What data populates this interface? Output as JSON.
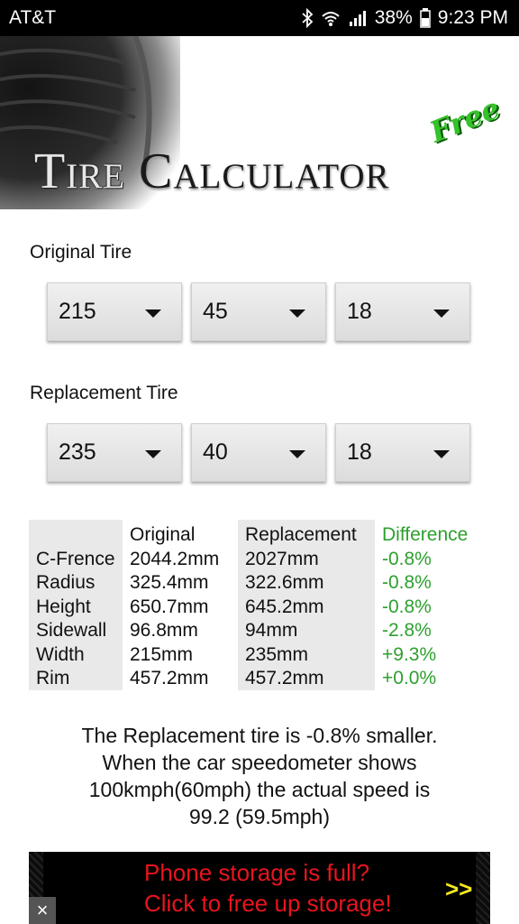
{
  "status_bar": {
    "carrier": "AT&T",
    "battery": "38%",
    "time": "9:23 PM",
    "icons": [
      "bluetooth-icon",
      "wifi-icon",
      "signal-icon",
      "battery-icon"
    ]
  },
  "header": {
    "title_first": "Tire",
    "title_rest": "Calculator",
    "badge": "Free",
    "badge_color": "#36c22a"
  },
  "original_tire": {
    "label": "Original Tire",
    "width": "215",
    "aspect": "45",
    "rim": "18"
  },
  "replacement_tire": {
    "label": "Replacement Tire",
    "width": "235",
    "aspect": "40",
    "rim": "18"
  },
  "table": {
    "headers": [
      "",
      "Original",
      "Replacement",
      "Difference"
    ],
    "rows": [
      {
        "name": "C-Frence",
        "original": "2044.2mm",
        "replacement": "2027mm",
        "difference": "-0.8%"
      },
      {
        "name": "Radius",
        "original": "325.4mm",
        "replacement": "322.6mm",
        "difference": "-0.8%"
      },
      {
        "name": "Height",
        "original": "650.7mm",
        "replacement": "645.2mm",
        "difference": "-0.8%"
      },
      {
        "name": "Sidewall",
        "original": "96.8mm",
        "replacement": "94mm",
        "difference": "-2.8%"
      },
      {
        "name": "Width",
        "original": "215mm",
        "replacement": "235mm",
        "difference": "+9.3%"
      },
      {
        "name": "Rim",
        "original": "457.2mm",
        "replacement": "457.2mm",
        "difference": "+0.0%"
      }
    ],
    "difference_color": "#2ea02e"
  },
  "summary": {
    "line1": "The Replacement tire is -0.8% smaller.",
    "line2": "When the car speedometer shows",
    "line3": "100kmph(60mph) the actual speed is",
    "line4": "99.2 (59.5mph)"
  },
  "ad": {
    "line1": "Phone storage is full?",
    "line2": "Click to free up storage!",
    "arrow": ">>",
    "close": "×",
    "text_color": "#e8141e"
  }
}
